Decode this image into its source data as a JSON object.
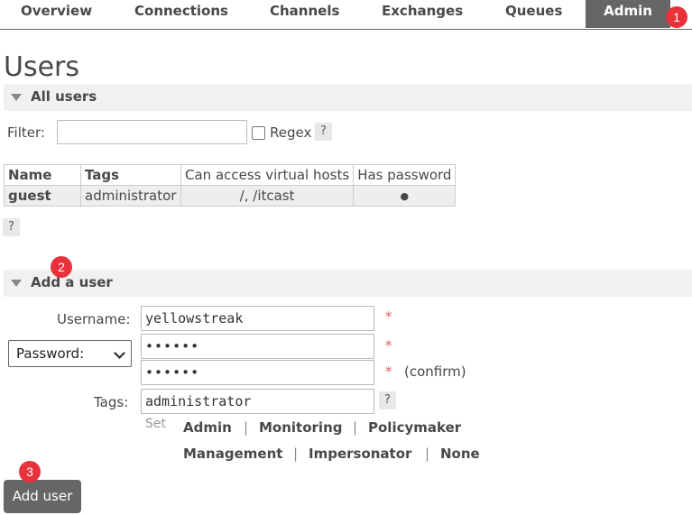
{
  "nav": {
    "items": [
      "Overview",
      "Connections",
      "Channels",
      "Exchanges",
      "Queues",
      "Admin"
    ],
    "active": "Admin"
  },
  "badges": [
    "1",
    "2",
    "3"
  ],
  "page": {
    "title": "Users"
  },
  "all_users": {
    "section_label": "All users",
    "filter_label": "Filter:",
    "filter_value": "",
    "regex_label": "Regex",
    "help": "?",
    "table": {
      "headers": [
        "Name",
        "Tags",
        "Can access virtual hosts",
        "Has password"
      ],
      "rows": [
        {
          "name": "guest",
          "tags": "administrator",
          "vhosts": "/, /itcast",
          "has_password": "●"
        }
      ]
    },
    "table_help": "?"
  },
  "add_user": {
    "section_label": "Add a user",
    "username_label": "Username:",
    "username_value": "yellowstreak",
    "password_select": "Password:",
    "password_value": "••••••",
    "confirm_value": "••••••",
    "confirm_label": "(confirm)",
    "required_mark": "*",
    "tags_label": "Tags:",
    "tags_value": "administrator",
    "tags_help": "?",
    "set_label": "Set",
    "tag_options_row1": [
      "Admin",
      "Monitoring",
      "Policymaker"
    ],
    "tag_options_row2": [
      "Management",
      "Impersonator",
      "None"
    ],
    "separator": "|",
    "submit_label": "Add user"
  },
  "colors": {
    "nav_active_bg": "#666666",
    "badge": "#e8323b",
    "section_bg": "#f1f1f1",
    "required": "#e06060"
  }
}
